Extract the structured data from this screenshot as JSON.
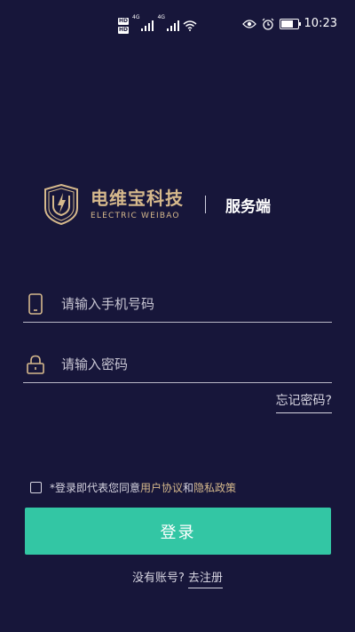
{
  "status_bar": {
    "hd_badge_1": "HD",
    "hd_badge_2": "HD",
    "net_1": "4G",
    "net_2": "4G",
    "time": "10:23",
    "battery_level": 0.85
  },
  "brand": {
    "name_cn": "电维宝科技",
    "name_en": "ELECTRIC WEIBAO",
    "service_label": "服务端",
    "accent_color": "#d6b98c"
  },
  "form": {
    "phone_placeholder": "请输入手机号码",
    "phone_value": "",
    "phone_icon": "mobile-phone-icon",
    "password_placeholder": "请输入密码",
    "password_value": "",
    "password_icon": "lock-icon",
    "forgot_label": "忘记密码?"
  },
  "agreement": {
    "checked": false,
    "prefix": "*登录即代表您同意",
    "user_agreement": "用户协议",
    "and": "和",
    "privacy_policy": "隐私政策"
  },
  "actions": {
    "login_label": "登录",
    "login_color": "#33c6a4",
    "no_account": "没有账号?",
    "register_label": "去注册"
  },
  "colors": {
    "background": "#17163a"
  }
}
